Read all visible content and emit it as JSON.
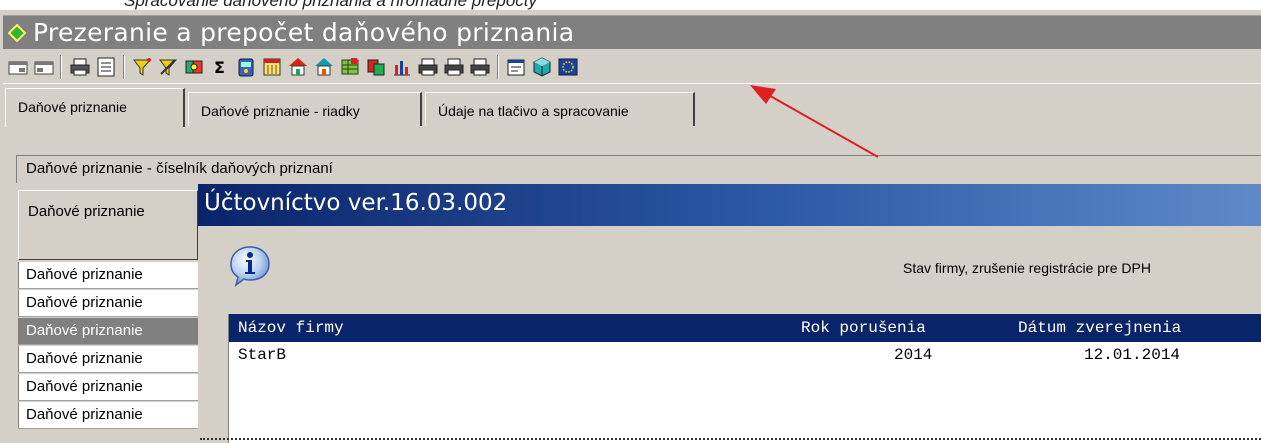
{
  "caption_fragment": "Spracovanie daňového priznania a hromadné prepočty",
  "window": {
    "title": "Prezeranie a prepočet daňového priznania",
    "icon": "green-diamond-icon"
  },
  "toolbar": {
    "icons": [
      "window-tile-icon",
      "window-cascade-icon",
      "print-icon",
      "print-preview-icon",
      "filter-icon",
      "clear-filter-icon",
      "search-icon",
      "sum-icon",
      "recycle-icon",
      "calendar-icon",
      "house-icon",
      "house-up-icon",
      "grid-settings-icon",
      "copy-icon",
      "chart-icon",
      "printer-icon-1",
      "printer-icon-2",
      "printer-icon-3",
      "properties-icon",
      "cube-icon",
      "eu-flag-icon"
    ]
  },
  "tabs": [
    {
      "label": "Daňové priznanie",
      "active": true
    },
    {
      "label": "Daňové priznanie - riadky",
      "active": false
    },
    {
      "label": "Údaje na tlačivo a spracovanie",
      "active": false
    }
  ],
  "panel": {
    "caption": "Daňové priznanie - číselník daňových priznaní",
    "header": "Daňové priznanie",
    "rows": [
      "Daňové priznanie",
      "Daňové priznanie",
      "Daňové priznanie",
      "Daňové priznanie",
      "Daňové priznanie",
      "Daňové priznanie"
    ]
  },
  "dialog": {
    "title": "Účtovníctvo ver.16.03.002",
    "icon": "info-icon",
    "message": "Stav firmy, zrušenie registrácie pre DPH",
    "columns": [
      "Názov firmy",
      "Rok porušenia",
      "Dátum zverejnenia"
    ],
    "rows": [
      {
        "name": "StarB",
        "year": "2014",
        "date": "12.01.2014"
      }
    ]
  },
  "colors": {
    "dialog_title": "#0a246a",
    "window_titlebar": "#808080",
    "annotation_arrow": "#e02020"
  }
}
